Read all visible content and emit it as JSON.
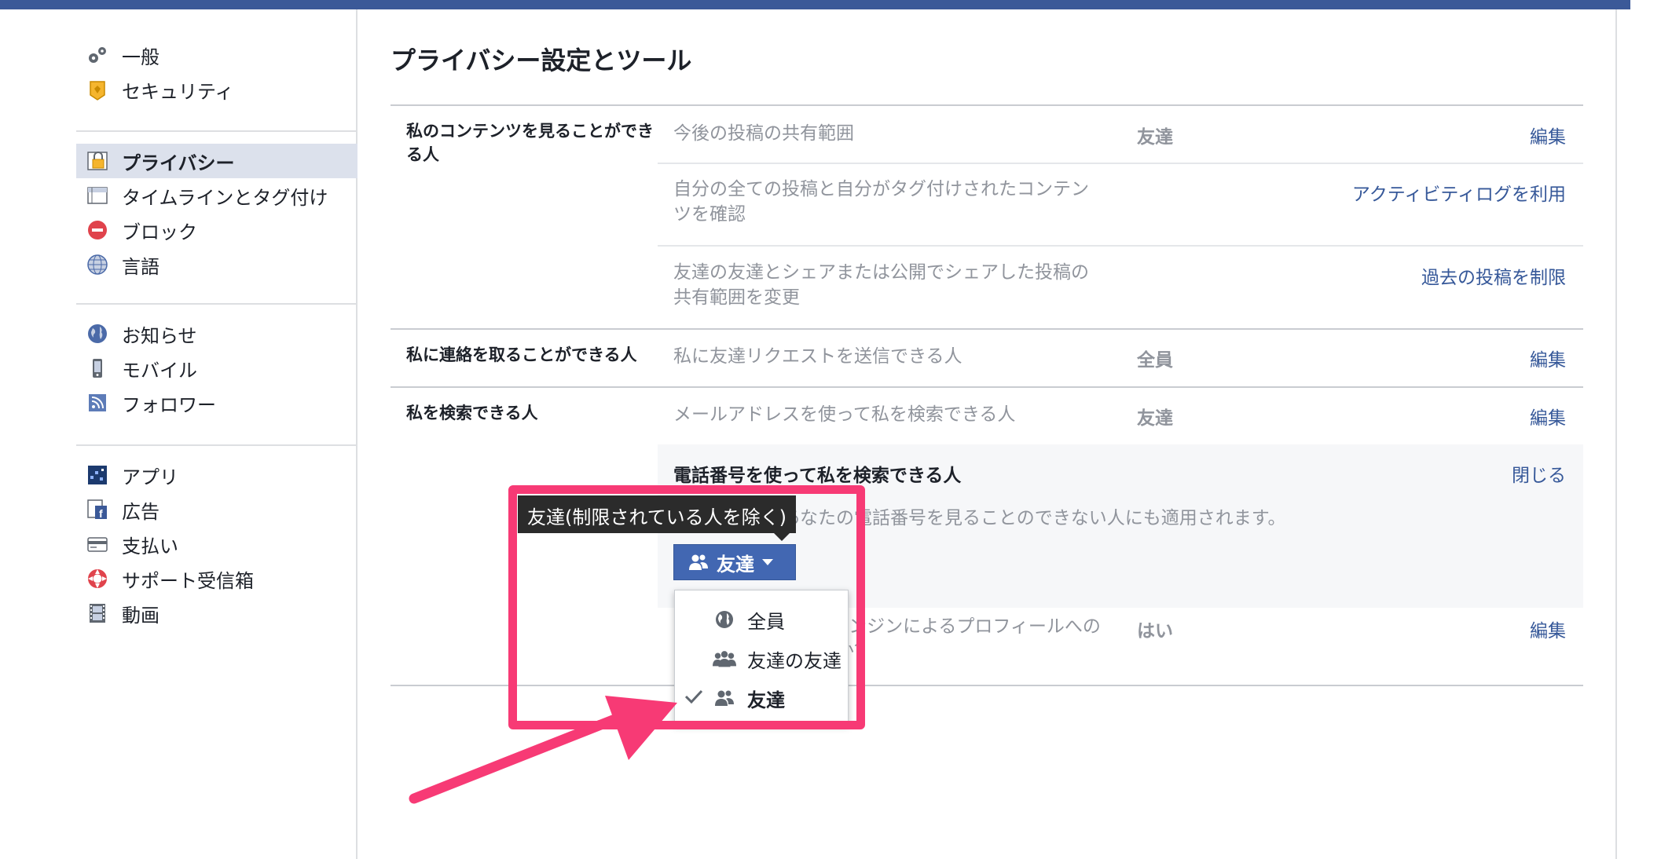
{
  "colors": {
    "brand": "#3b5998",
    "link": "#365899",
    "highlight": "#f73a75",
    "button": "#4267b2"
  },
  "sidebar": {
    "groups": [
      [
        {
          "label": "一般",
          "icon": "gears-icon"
        },
        {
          "label": "セキュリティ",
          "icon": "badge-icon"
        }
      ],
      [
        {
          "label": "プライバシー",
          "icon": "lock-icon",
          "active": true
        },
        {
          "label": "タイムラインとタグ付け",
          "icon": "timeline-icon"
        },
        {
          "label": "ブロック",
          "icon": "block-icon"
        },
        {
          "label": "言語",
          "icon": "globe-grid-icon"
        }
      ],
      [
        {
          "label": "お知らせ",
          "icon": "globe-icon"
        },
        {
          "label": "モバイル",
          "icon": "mobile-icon"
        },
        {
          "label": "フォロワー",
          "icon": "rss-icon"
        }
      ],
      [
        {
          "label": "アプリ",
          "icon": "apps-icon"
        },
        {
          "label": "広告",
          "icon": "ads-icon"
        },
        {
          "label": "支払い",
          "icon": "card-icon"
        },
        {
          "label": "サポート受信箱",
          "icon": "lifebuoy-icon"
        },
        {
          "label": "動画",
          "icon": "film-icon"
        }
      ]
    ]
  },
  "main": {
    "title": "プライバシー設定とツール",
    "sections": [
      {
        "label": "私のコンテンツを見ることができる人",
        "rows": [
          {
            "label": "今後の投稿の共有範囲",
            "value": "友達",
            "action": "編集"
          },
          {
            "label": "自分の全ての投稿と自分がタグ付けされたコンテンツを確認",
            "value": "",
            "action": "アクティビティログを利用"
          },
          {
            "label": "友達の友達とシェアまたは公開でシェアした投稿の共有範囲を変更",
            "value": "",
            "action": "過去の投稿を制限"
          }
        ]
      },
      {
        "label": "私に連絡を取ることができる人",
        "rows": [
          {
            "label": "私に友達リクエストを送信できる人",
            "value": "全員",
            "action": "編集"
          }
        ]
      },
      {
        "label": "私を検索できる人",
        "rows": [
          {
            "label": "メールアドレスを使って私を検索できる人",
            "value": "友達",
            "action": "編集"
          },
          {
            "label": "電話番号を使って私を検索できる人",
            "value": "",
            "action": "閉じる",
            "expanded": true,
            "description": "この設定は、あなたの電話番号を見ることのできない人にも適用されます。"
          },
          {
            "label": "Facebook外の検索エンジンによるプロフィールへのリンクを許可しますか？",
            "value": "はい",
            "action": "編集"
          }
        ]
      }
    ]
  },
  "privacy_selector": {
    "tooltip": "友達(制限されている人を除く)",
    "button_label": "友達",
    "options": [
      {
        "label": "全員",
        "icon": "globe-icon",
        "selected": false
      },
      {
        "label": "友達の友達",
        "icon": "friends-of-friends-icon",
        "selected": false
      },
      {
        "label": "友達",
        "icon": "friends-icon",
        "selected": true
      }
    ]
  }
}
